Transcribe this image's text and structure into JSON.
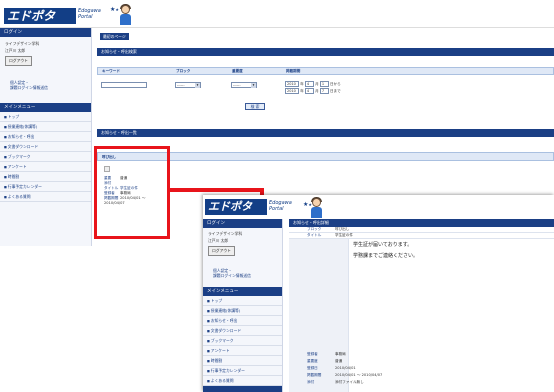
{
  "brand": {
    "logo_text": "エドポタ",
    "logo_sub_1": "Edogawa",
    "logo_sub_2": "Portal"
  },
  "sidebar": {
    "login_header": "ログイン",
    "school_name": "ライフデザイン学科",
    "user_name": "江戸川 太郎",
    "logout_button": "ログアウト",
    "personal_link": "個人認定・\n課題ログイン情報送信",
    "menu_header": "メインメニュー",
    "items": [
      {
        "label": "トップ"
      },
      {
        "label": "授業連絡(休講等)"
      },
      {
        "label": "お知らせ・呼出"
      },
      {
        "label": "文書ダウンロード"
      },
      {
        "label": "ブックマーク"
      },
      {
        "label": "アンケート"
      },
      {
        "label": "時間割"
      },
      {
        "label": "行事予定カレンダー"
      },
      {
        "label": "よくある質問"
      }
    ]
  },
  "main": {
    "breadcrumb": "最初のページ",
    "search_panel_title": "お知らせ・呼出検索",
    "search_cols": [
      "キーワード",
      "ブロック",
      "重要度",
      "掲載期間"
    ],
    "select_default": "------",
    "date_from": {
      "year": "2010",
      "year_unit": "年",
      "month": "4",
      "month_unit": "月",
      "day": "1",
      "day_suffix": "日から"
    },
    "date_to": {
      "year": "2010",
      "year_unit": "年",
      "month": "4",
      "month_unit": "月",
      "day": "7",
      "day_suffix": "日まで"
    },
    "search_button": "検 索",
    "list_panel_title": "お知らせ・呼出一覧",
    "list_bar_title": "呼び出し",
    "item": {
      "rows": [
        {
          "k": "重要",
          "v": "普通"
        },
        {
          "k": "添付",
          "v": ""
        },
        {
          "k": "タイトル",
          "v": "学生証の件"
        },
        {
          "k": "登録者",
          "v": "事務局"
        },
        {
          "k": "掲載期間",
          "v": "2010/04/01 ～ 2010/04/07"
        }
      ]
    }
  },
  "detail": {
    "panel_title": "お知らせ・呼出詳細",
    "rows_top": [
      {
        "k": "ブロック",
        "v": "呼び出し"
      },
      {
        "k": "タイトル",
        "v": "学生証の件"
      }
    ],
    "body_lines": [
      "学生証が届いております。",
      "",
      "学務課までご連絡ください。"
    ],
    "rows_bottom": [
      {
        "k": "登録者",
        "v": "事務局"
      },
      {
        "k": "重要度",
        "v": "普通"
      },
      {
        "k": "登録日",
        "v": "2010/04/01"
      },
      {
        "k": "掲載期間",
        "v": "2010/04/01 ～ 2010/04/07"
      },
      {
        "k": "添付",
        "v": "添付ファイル無し"
      }
    ]
  },
  "colors": {
    "accent": "#1b3f85",
    "highlight": "#e8141b"
  }
}
